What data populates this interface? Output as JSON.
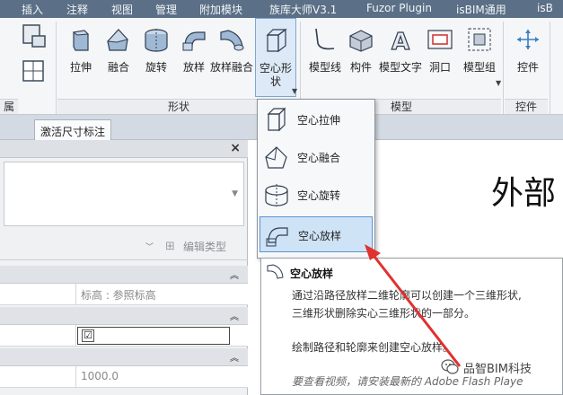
{
  "menu_tabs": [
    "插入",
    "注释",
    "视图",
    "管理",
    "附加模块",
    "族库大师V3.1",
    "Fuzor Plugin",
    "isBIM通用",
    "isB"
  ],
  "ribbon": {
    "left_panel_label": "属性",
    "shape_panel_label": "形状",
    "model_panel_label": "模型",
    "control_panel_label": "控件",
    "shape_tools": [
      "拉伸",
      "融合",
      "旋转",
      "放样",
      "放样融合",
      "空心形状"
    ],
    "model_tools": [
      "模型线",
      "构件",
      "模型文字",
      "洞口",
      "模型组"
    ],
    "control_tool": "控件"
  },
  "context_tab": "激活尺寸标注",
  "properties": {
    "close_label": "×",
    "edit_type_label": "编辑类型",
    "rows": [
      {
        "value": "标高 : 参照标高"
      },
      {
        "value": "☑"
      },
      {
        "value": "1000.0"
      }
    ]
  },
  "canvas_title": "外部",
  "dropdown": {
    "items": [
      "空心拉伸",
      "空心融合",
      "空心旋转",
      "空心放样"
    ],
    "highlighted_index": 3
  },
  "tooltip": {
    "title": "空心放样",
    "lines": [
      "通过沿路径放样二维轮廓可以创建一个三维形状,",
      "三维形状删除实心三维形状的一部分。",
      "绘制路径和轮廓来创建空心放样。"
    ],
    "more": "要查看视频，请安装最新的 Adobe Flash Playe"
  },
  "watermark": "品智BIM科技",
  "colors": {
    "menu_bar": "#5b6f86",
    "ribbon_bg": "#f5f6f8",
    "highlight": "#cfe3f7",
    "highlight_border": "#5b94cf",
    "arrow": "#e0312f"
  }
}
